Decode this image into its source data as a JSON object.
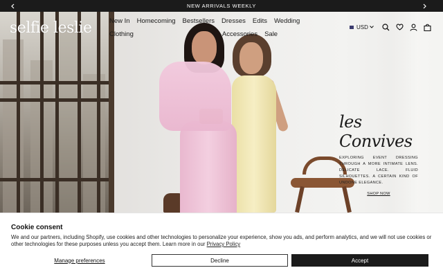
{
  "announcement": {
    "text": "NEW ARRIVALS WEEKLY",
    "prev_icon": "chevron-left-icon",
    "next_icon": "chevron-right-icon"
  },
  "header": {
    "logo_text": "selfie leslie",
    "nav": [
      "New In",
      "Homecoming",
      "Bestsellers",
      "Dresses",
      "Edits",
      "Wedding",
      "Clothing",
      "Accessories",
      "Sale"
    ],
    "currency": "USD",
    "icons": [
      "search-icon",
      "heart-icon",
      "account-icon",
      "bag-icon"
    ]
  },
  "hero": {
    "script_title": "les Convives",
    "description": "Exploring event dressing through a more intimate lens. Delicate lace. Fluid silhouettes. A certain kind of undone elegance.",
    "cta": "SHOP NOW"
  },
  "cookie": {
    "title": "Cookie consent",
    "body": "We and our partners, including Shopify, use cookies and other technologies to personalize your experience, show you ads, and perform analytics, and we will not use cookies or other technologies for these purposes unless you accept them. Learn more in our",
    "policy_link": "Privacy Policy",
    "manage": "Manage preferences",
    "decline": "Decline",
    "accept": "Accept"
  }
}
